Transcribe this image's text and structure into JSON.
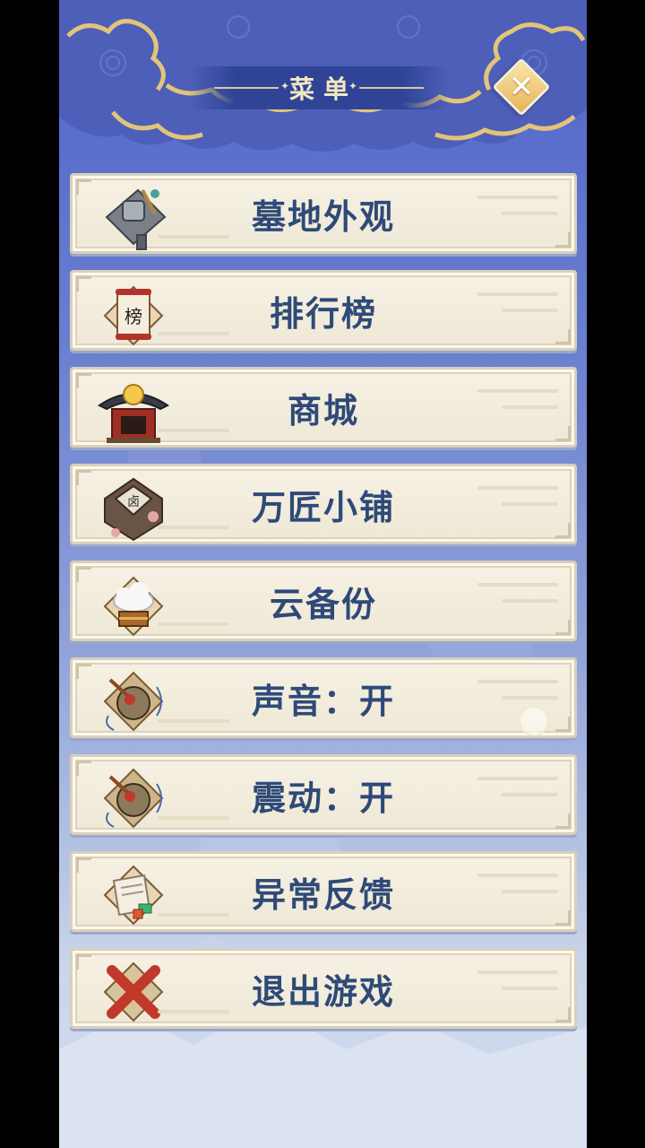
{
  "header": {
    "title": "菜单",
    "close_icon": "close-icon"
  },
  "menu": {
    "items": [
      {
        "label": "墓地外观",
        "icon": "tombstone-icon"
      },
      {
        "label": "排行榜",
        "icon": "ranking-scroll-icon"
      },
      {
        "label": "商城",
        "icon": "shop-pavilion-icon"
      },
      {
        "label": "万匠小铺",
        "icon": "craft-shop-icon"
      },
      {
        "label": "云备份",
        "icon": "cloud-backup-icon"
      },
      {
        "label": "声音：开",
        "icon": "gong-sound-icon"
      },
      {
        "label": "震动：开",
        "icon": "gong-vibration-icon"
      },
      {
        "label": "异常反馈",
        "icon": "feedback-paper-icon"
      },
      {
        "label": "退出游戏",
        "icon": "red-x-icon"
      }
    ]
  },
  "colors": {
    "panel_top": "#4f63c8",
    "label": "#2e4a78",
    "title": "#f3e6c0",
    "cloud_gold": "#e2c47a"
  }
}
